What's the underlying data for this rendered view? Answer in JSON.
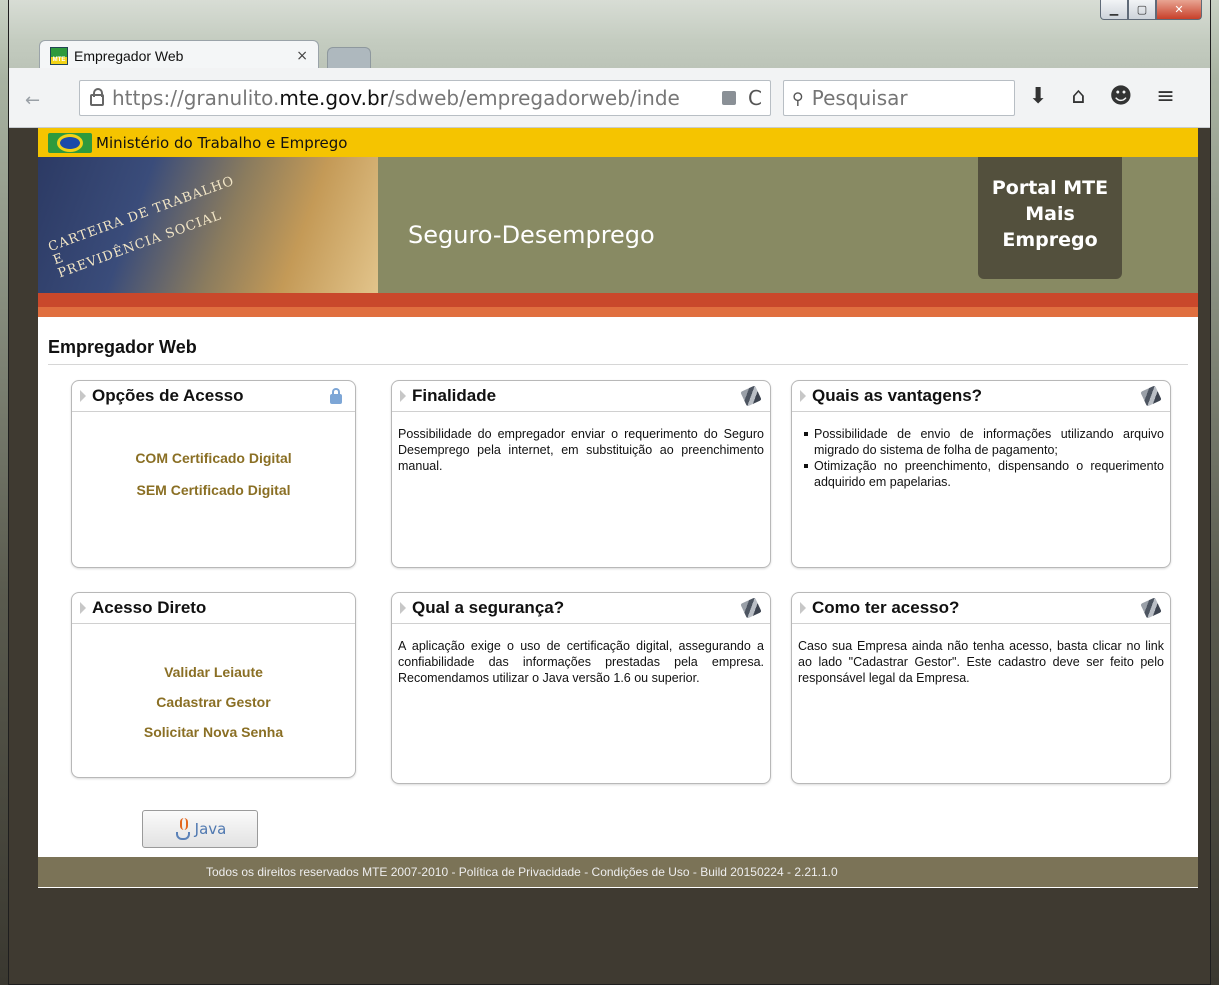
{
  "browser": {
    "tab_title": "Empregador Web",
    "tab_close": "×",
    "url_prefix": "https://granulito.",
    "url_domain": "mte.gov.br",
    "url_path": "/sdweb/empregadorweb/inde",
    "search_placeholder": "Pesquisar"
  },
  "gov": {
    "ministry": "Ministério do Trabalho e Emprego"
  },
  "banner": {
    "card_text": "CARTEIRA DE TRABALHO\nE\nPREVIDÊNCIA SOCIAL",
    "title": "Seguro-Desemprego",
    "portal_line1": "Portal MTE",
    "portal_line2": "Mais",
    "portal_line3": "Emprego"
  },
  "page": {
    "heading": "Empregador Web"
  },
  "panels": {
    "opcoes": {
      "title": "Opções de Acesso",
      "links": [
        "COM Certificado Digital",
        "SEM Certificado Digital"
      ]
    },
    "finalidade": {
      "title": "Finalidade",
      "text": "Possibilidade do empregador enviar o requerimento do Seguro Desemprego pela internet, em substituição ao preenchimento manual."
    },
    "vantagens": {
      "title": "Quais as vantagens?",
      "items": [
        "Possibilidade de envio de informações utilizando arquivo migrado do sistema de folha de pagamento;",
        "Otimização no preenchimento, dispensando o requerimento adquirido em papelarias."
      ]
    },
    "acesso_direto": {
      "title": "Acesso Direto",
      "links": [
        "Validar Leiaute",
        "Cadastrar Gestor",
        "Solicitar Nova Senha"
      ]
    },
    "seguranca": {
      "title": "Qual a segurança?",
      "text": "A aplicação exige o uso de certificação digital, assegurando a confiabilidade das informações prestadas pela empresa. Recomendamos utilizar o Java versão 1.6 ou superior."
    },
    "como_acesso": {
      "title": "Como ter acesso?",
      "text": "Caso sua Empresa ainda não tenha acesso, basta clicar no link ao lado \"Cadastrar Gestor\". Este cadastro deve ser feito pelo responsável legal da Empresa."
    }
  },
  "java": {
    "label": "Java"
  },
  "footer": {
    "text": "Todos os direitos reservados MTE 2007-2010 - Política de Privacidade - Condições de Uso - Build 20150224 - 2.21.1.0"
  },
  "colors": {
    "gov_yellow": "#f5c400",
    "banner_olive": "#888a63",
    "stripe_red": "#c9482b",
    "link_gold": "#8a6f24",
    "footer_brown": "#7b7357"
  }
}
